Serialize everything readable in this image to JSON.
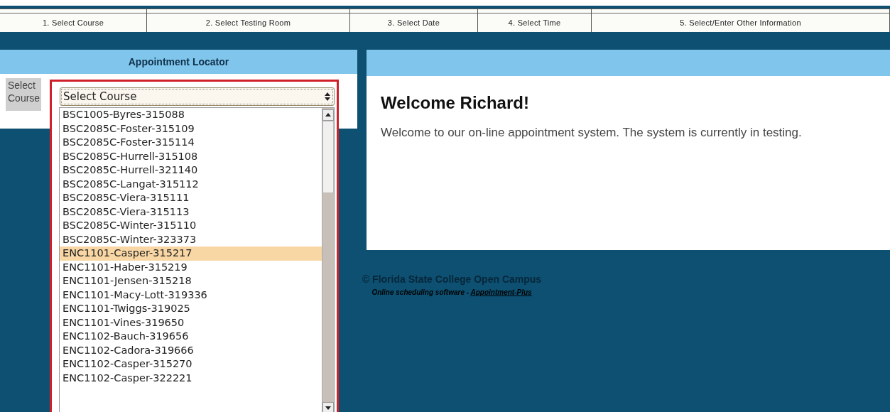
{
  "steps": [
    {
      "label": "1. Select Course"
    },
    {
      "label": "2. Select Testing Room"
    },
    {
      "label": "3. Select Date"
    },
    {
      "label": "4. Select Time"
    },
    {
      "label": "5. Select/Enter Other Information"
    }
  ],
  "locator": {
    "title": "Appointment Locator",
    "field_label": "Select Course",
    "select_value": "Select Course"
  },
  "course_options": [
    {
      "label": "BSC1005-Byres-315088",
      "selected": false
    },
    {
      "label": "BSC2085C-Foster-315109",
      "selected": false
    },
    {
      "label": "BSC2085C-Foster-315114",
      "selected": false
    },
    {
      "label": "BSC2085C-Hurrell-315108",
      "selected": false
    },
    {
      "label": "BSC2085C-Hurrell-321140",
      "selected": false
    },
    {
      "label": "BSC2085C-Langat-315112",
      "selected": false
    },
    {
      "label": "BSC2085C-Viera-315111",
      "selected": false
    },
    {
      "label": "BSC2085C-Viera-315113",
      "selected": false
    },
    {
      "label": "BSC2085C-Winter-315110",
      "selected": false
    },
    {
      "label": "BSC2085C-Winter-323373",
      "selected": false
    },
    {
      "label": "ENC1101-Casper-315217",
      "selected": true
    },
    {
      "label": "ENC1101-Haber-315219",
      "selected": false
    },
    {
      "label": "ENC1101-Jensen-315218",
      "selected": false
    },
    {
      "label": "ENC1101-Macy-Lott-319336",
      "selected": false
    },
    {
      "label": "ENC1101-Twiggs-319025",
      "selected": false
    },
    {
      "label": "ENC1101-Vines-319650",
      "selected": false
    },
    {
      "label": "ENC1102-Bauch-319656",
      "selected": false
    },
    {
      "label": "ENC1102-Cadora-319666",
      "selected": false
    },
    {
      "label": "ENC1102-Casper-315270",
      "selected": false
    },
    {
      "label": "ENC1102-Casper-322221",
      "selected": false
    }
  ],
  "welcome": {
    "heading": "Welcome Richard!",
    "text": "Welcome to our on-line appointment system. The system is currently in testing."
  },
  "footer": {
    "copyright": "© Florida State College Open Campus",
    "note": "Online scheduling software - ",
    "link": "Appointment-Plus"
  }
}
